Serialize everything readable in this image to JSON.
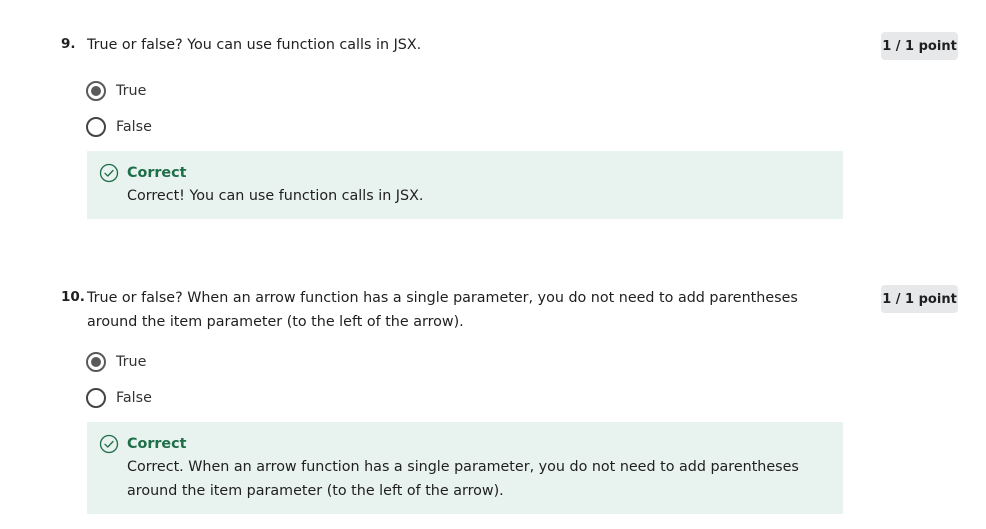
{
  "questions": [
    {
      "number": "9.",
      "text": "True or false? You can use function calls in JSX.",
      "points": "1 / 1 point",
      "options": [
        {
          "label": "True",
          "selected": true
        },
        {
          "label": "False",
          "selected": false
        }
      ],
      "feedback": {
        "status": "Correct",
        "message": "Correct! You can use function calls in JSX."
      }
    },
    {
      "number": "10.",
      "text": "True or false? When an arrow function has a single parameter, you do not need to add parentheses around the item parameter (to the left of the arrow).",
      "points": "1 / 1 point",
      "options": [
        {
          "label": "True",
          "selected": true
        },
        {
          "label": "False",
          "selected": false
        }
      ],
      "feedback": {
        "status": "Correct",
        "message": "Correct. When an arrow function has a single parameter, you do not need to add parentheses around the item parameter (to the left of the arrow)."
      }
    }
  ],
  "colors": {
    "feedback_bg": "#e8f2ee",
    "correct_green": "#1e6e48",
    "badge_bg": "#e6e8e9"
  },
  "icons": {
    "selected_radio": "radio-selected-icon",
    "unselected_radio": "radio-unselected-icon",
    "correct": "check-circle-icon"
  }
}
